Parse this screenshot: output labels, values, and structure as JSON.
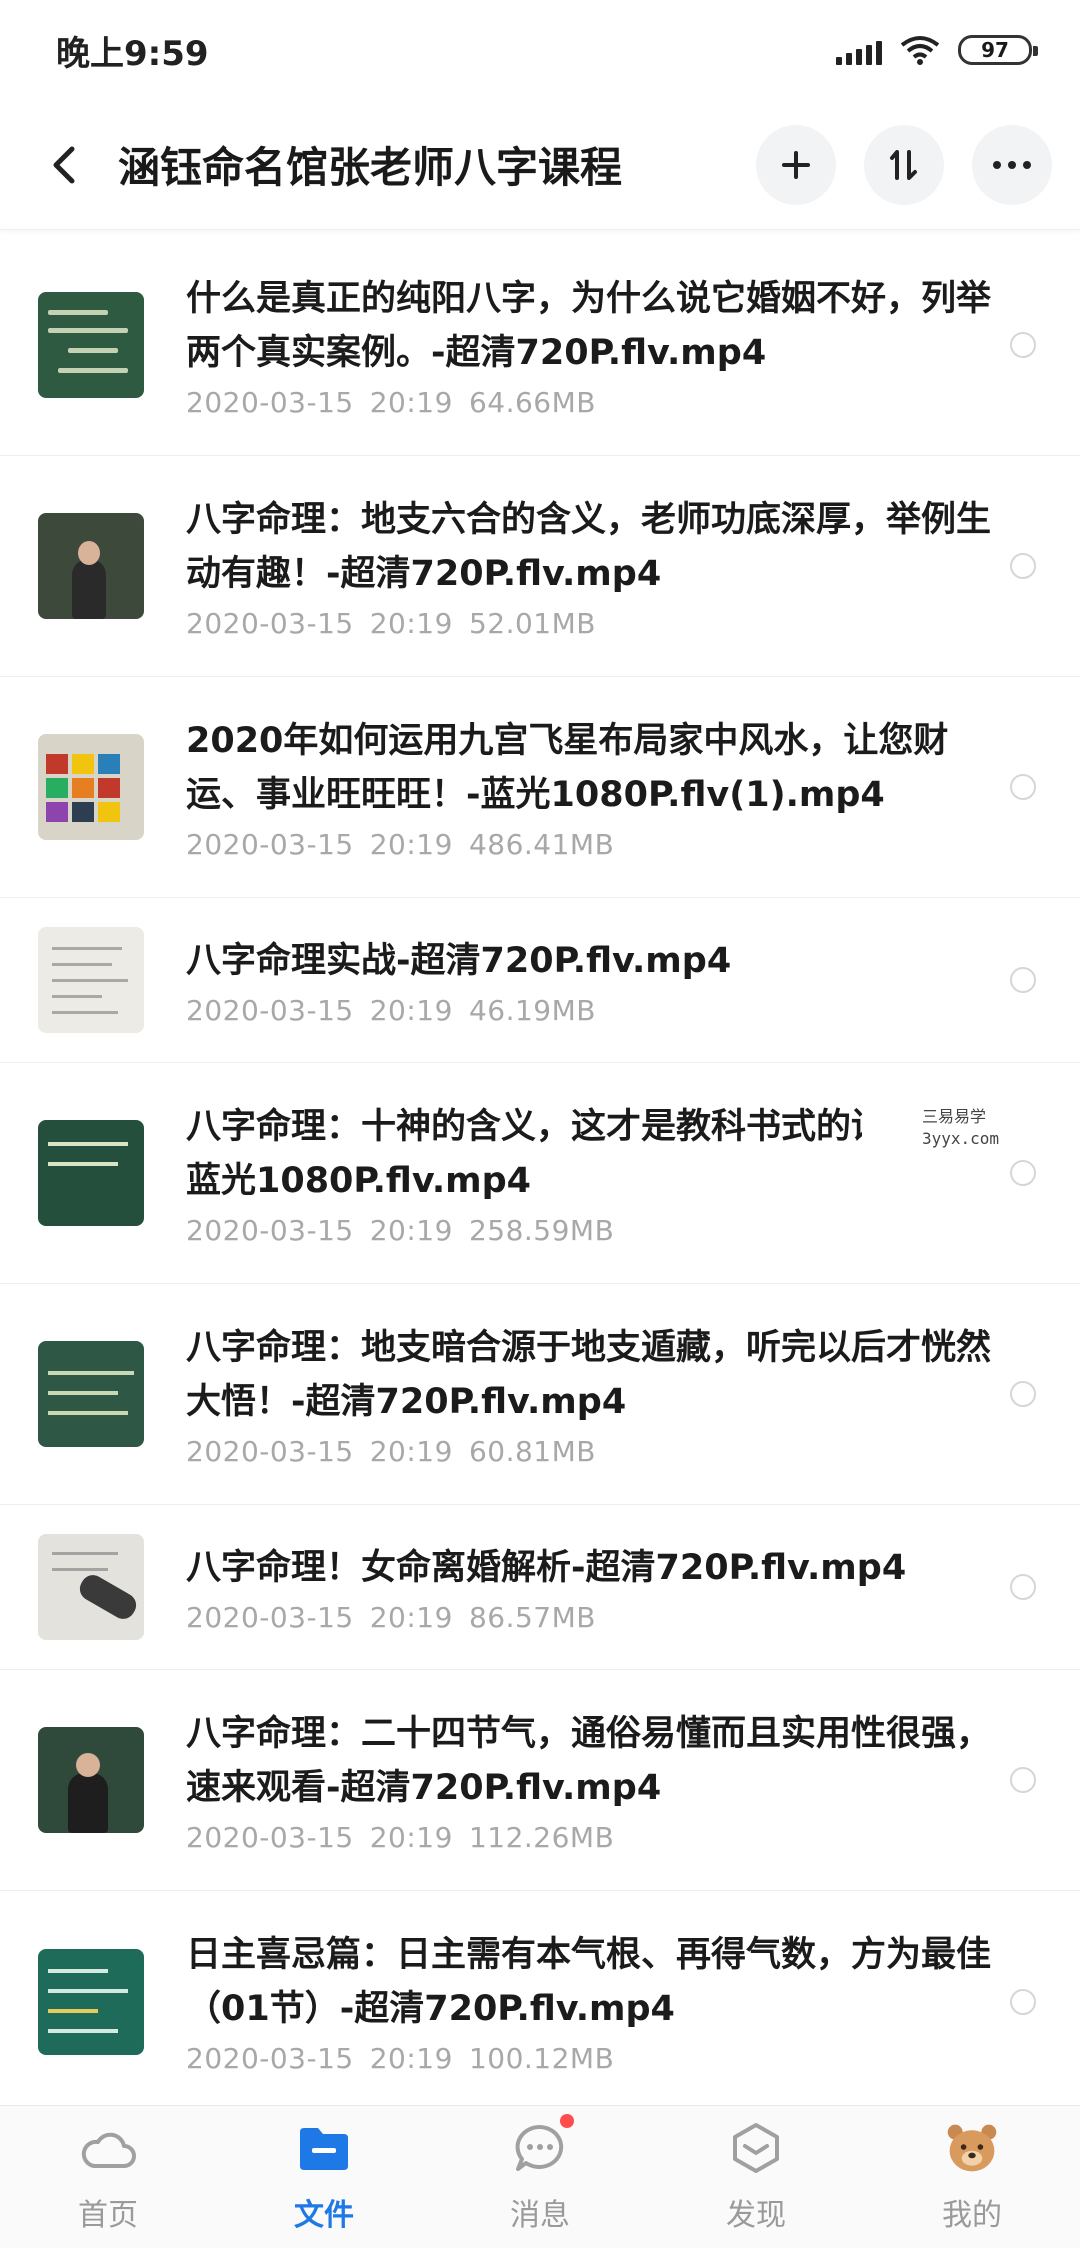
{
  "status_bar": {
    "time": "晚上9:59",
    "battery": "97"
  },
  "header": {
    "title": "涵钰命名馆张老师八字课程",
    "back_icon": "chevron-left-icon",
    "add_icon": "plus-icon",
    "sort_icon": "sort-icon",
    "more_icon": "more-dots-icon"
  },
  "files": [
    {
      "name": "什么是真正的纯阳八字，为什么说它婚姻不好，列举两个真实案例。-超清720P.flv.mp4",
      "date": "2020-03-15",
      "time": "20:19",
      "size": "64.66MB"
    },
    {
      "name": "八字命理：地支六合的含义，老师功底深厚，举例生动有趣！-超清720P.flv.mp4",
      "date": "2020-03-15",
      "time": "20:19",
      "size": "52.01MB"
    },
    {
      "name": "2020年如何运用九宫飞星布局家中风水，让您财运、事业旺旺旺！-蓝光1080P.flv(1).mp4",
      "date": "2020-03-15",
      "time": "20:19",
      "size": "486.41MB"
    },
    {
      "name": "八字命理实战-超清720P.flv.mp4",
      "date": "2020-03-15",
      "time": "20:19",
      "size": "46.19MB"
    },
    {
      "name": "八字命理：十神的含义，这才是教科书式的讲述！-蓝光1080P.flv.mp4",
      "date": "2020-03-15",
      "time": "20:19",
      "size": "258.59MB"
    },
    {
      "name": "八字命理：地支暗合源于地支遁藏，听完以后才恍然大悟！-超清720P.flv.mp4",
      "date": "2020-03-15",
      "time": "20:19",
      "size": "60.81MB"
    },
    {
      "name": "八字命理！女命离婚解析-超清720P.flv.mp4",
      "date": "2020-03-15",
      "time": "20:19",
      "size": "86.57MB"
    },
    {
      "name": "八字命理：二十四节气，通俗易懂而且实用性很强，速来观看-超清720P.flv.mp4",
      "date": "2020-03-15",
      "time": "20:19",
      "size": "112.26MB"
    },
    {
      "name": "日主喜忌篇：日主需有本气根、再得气数，方为最佳（01节）-超清720P.flv.mp4",
      "date": "2020-03-15",
      "time": "20:19",
      "size": "100.12MB"
    }
  ],
  "watermark": {
    "line1": "三易易学",
    "line2": "3yyx.com"
  },
  "nav": [
    {
      "label": "首页",
      "icon": "cloud-icon"
    },
    {
      "label": "文件",
      "icon": "folder-icon"
    },
    {
      "label": "消息",
      "icon": "chat-bubble-icon"
    },
    {
      "label": "发现",
      "icon": "discover-icon"
    },
    {
      "label": "我的",
      "icon": "bear-avatar-icon"
    }
  ],
  "colors": {
    "accent": "#1e78e6",
    "notification": "#ff4d4f"
  }
}
